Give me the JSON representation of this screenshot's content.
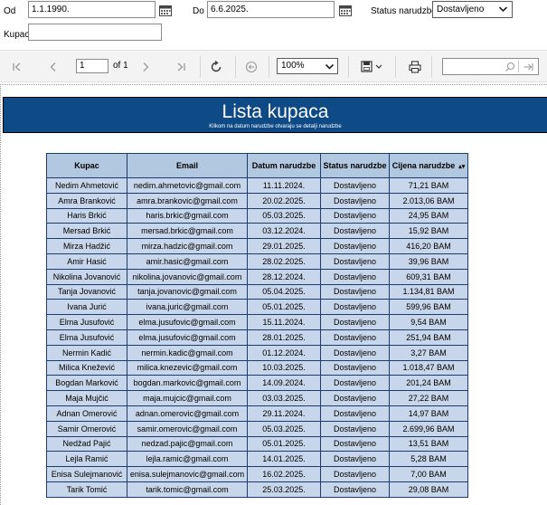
{
  "params": {
    "od_label": "Od",
    "od_value": "1.1.1990.",
    "do_label": "Do",
    "do_value": "6.6.2025.",
    "status_label": "Status narudzbe",
    "status_value": "Dostavljeno",
    "kupac_label": "Kupac",
    "kupac_value": ""
  },
  "toolbar": {
    "page_current": "1",
    "page_of": "of 1",
    "zoom": "100%",
    "find_value": ""
  },
  "report": {
    "title": "Lista kupaca",
    "subtitle": "Klikom na datum narudzbe otvaraju se detalji narudzbe",
    "columns": [
      "Kupac",
      "Email",
      "Datum narudzbe",
      "Status narudzbe",
      "Cijena narudzbe"
    ],
    "rows": [
      [
        "Nedim Ahmetović",
        "nedim.ahmetovic@gmail.com",
        "11.11.2024.",
        "Dostavljeno",
        "71,21 BAM"
      ],
      [
        "Amra Branković",
        "amra.brankovic@gmail.com",
        "20.02.2025.",
        "Dostavljeno",
        "2.013,06 BAM"
      ],
      [
        "Haris Brkić",
        "haris.brkic@gmail.com",
        "05.03.2025.",
        "Dostavljeno",
        "24,95 BAM"
      ],
      [
        "Mersad Brkić",
        "mersad.brkic@gmail.com",
        "03.12.2024.",
        "Dostavljeno",
        "15,92 BAM"
      ],
      [
        "Mirza Hadžić",
        "mirza.hadzic@gmail.com",
        "29.01.2025.",
        "Dostavljeno",
        "416,20 BAM"
      ],
      [
        "Amir Hasić",
        "amir.hasic@gmail.com",
        "28.02.2025.",
        "Dostavljeno",
        "39,96 BAM"
      ],
      [
        "Nikolina Jovanović",
        "nikolina.jovanovic@gmail.com",
        "28.12.2024.",
        "Dostavljeno",
        "609,31 BAM"
      ],
      [
        "Tanja Jovanović",
        "tanja.jovanovic@gmail.com",
        "05.04.2025.",
        "Dostavljeno",
        "1.134,81 BAM"
      ],
      [
        "Ivana Jurić",
        "ivana.juric@gmail.com",
        "05.01.2025.",
        "Dostavljeno",
        "599,96 BAM"
      ],
      [
        "Elma Jusufović",
        "elma.jusufovic@gmail.com",
        "15.11.2024.",
        "Dostavljeno",
        "9,54 BAM"
      ],
      [
        "Elma Jusufović",
        "elma.jusufovic@gmail.com",
        "28.01.2025.",
        "Dostavljeno",
        "251,94 BAM"
      ],
      [
        "Nermin Kadić",
        "nermin.kadic@gmail.com",
        "01.12.2024.",
        "Dostavljeno",
        "3,27 BAM"
      ],
      [
        "Milica Knežević",
        "milica.knezevic@gmail.com",
        "10.03.2025.",
        "Dostavljeno",
        "1.018,47 BAM"
      ],
      [
        "Bogdan Marković",
        "bogdan.markovic@gmail.com",
        "14.09.2024.",
        "Dostavljeno",
        "201,24 BAM"
      ],
      [
        "Maja Mujčić",
        "maja.mujcic@gmail.com",
        "03.03.2025.",
        "Dostavljeno",
        "27,22 BAM"
      ],
      [
        "Adnan Omerović",
        "adnan.omerovic@gmail.com",
        "29.11.2024.",
        "Dostavljeno",
        "14,97 BAM"
      ],
      [
        "Samir Omerović",
        "samir.omerovic@gmail.com",
        "05.03.2025.",
        "Dostavljeno",
        "2.699,96 BAM"
      ],
      [
        "Nedžad Pajić",
        "nedzad.pajic@gmail.com",
        "05.01.2025.",
        "Dostavljeno",
        "13,51 BAM"
      ],
      [
        "Lejla Ramić",
        "lejla.ramic@gmail.com",
        "14.01.2025.",
        "Dostavljeno",
        "5,28 BAM"
      ],
      [
        "Enisa Sulejmanović",
        "enisa.sulejmanovic@gmail.com",
        "16.02.2025.",
        "Dostavljeno",
        "7,00 BAM"
      ],
      [
        "Tarik Tomić",
        "tarik.tomic@gmail.com",
        "25.03.2025.",
        "Dostavljeno",
        "29,08 BAM"
      ]
    ]
  },
  "colors": {
    "banner": "#0e4a86",
    "header_cell": "#b2c8e0",
    "data_cell": "#c7d6ea",
    "grid_line": "#1a3d6e"
  }
}
